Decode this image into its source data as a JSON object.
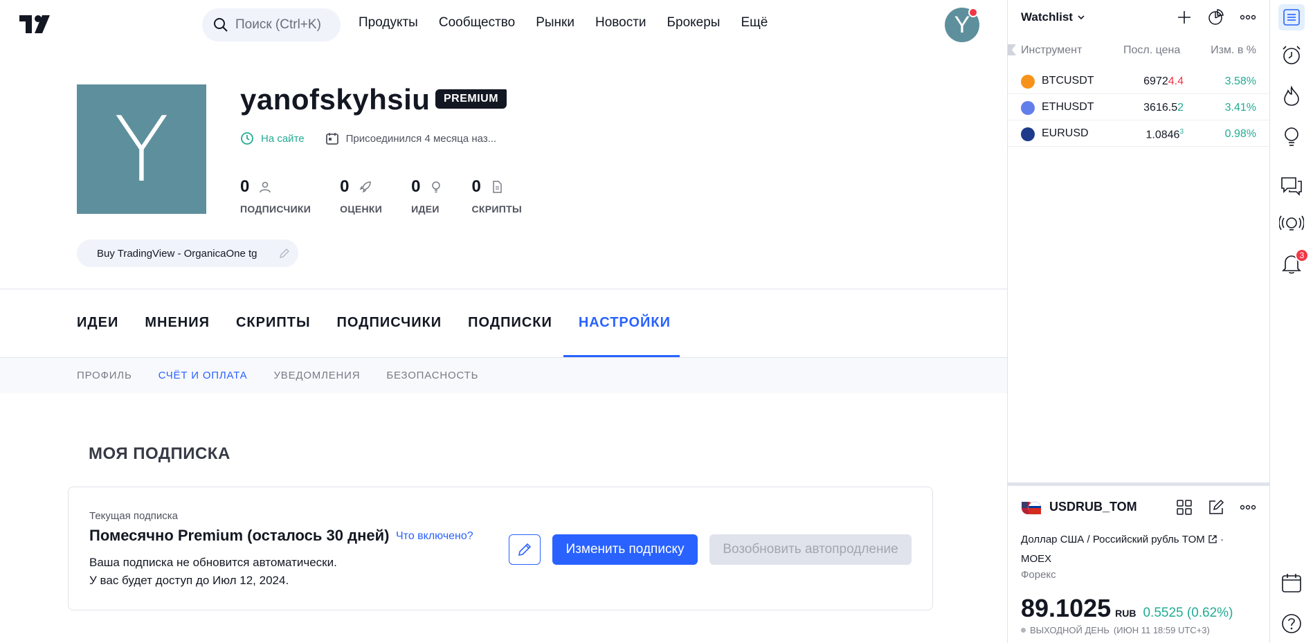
{
  "header": {
    "search_placeholder": "Поиск (Ctrl+K)",
    "nav": [
      "Продукты",
      "Сообщество",
      "Рынки",
      "Новости",
      "Брокеры",
      "Ещё"
    ],
    "avatar_letter": "Y"
  },
  "profile": {
    "avatar_letter": "Y",
    "username": "yanofskyhsiu",
    "badge": "PREMIUM",
    "online": "На сайте",
    "joined": "Присоединился 4 месяца наз...",
    "stats": [
      {
        "value": "0",
        "label": "ПОДПИСЧИКИ"
      },
      {
        "value": "0",
        "label": "ОЦЕНКИ"
      },
      {
        "value": "0",
        "label": "ИДЕИ"
      },
      {
        "value": "0",
        "label": "СКРИПТЫ"
      }
    ],
    "bio": "Buy TradingView - OrganicaOne tg"
  },
  "tabs": [
    "ИДЕИ",
    "МНЕНИЯ",
    "СКРИПТЫ",
    "ПОДПИСЧИКИ",
    "ПОДПИСКИ",
    "НАСТРОЙКИ"
  ],
  "active_tab": "НАСТРОЙКИ",
  "subtabs": [
    "ПРОФИЛЬ",
    "СЧЁТ И ОПЛАТА",
    "УВЕДОМЛЕНИЯ",
    "БЕЗОПАСНОСТЬ"
  ],
  "active_subtab": "СЧЁТ И ОПЛАТА",
  "subscription": {
    "section_title": "МОЯ ПОДПИСКА",
    "caption": "Текущая подписка",
    "plan": "Помесячно Premium (осталось 30 дней)",
    "included_link": "Что включено?",
    "line1": "Ваша подписка не обновится автоматически.",
    "line2": "У вас будет доступ до Июл 12, 2024.",
    "change_button": "Изменить подписку",
    "renew_button": "Возобновить автопродление"
  },
  "watchlist": {
    "title": "Watchlist",
    "columns": [
      "Инструмент",
      "Посл. цена",
      "Изм. в %"
    ],
    "rows": [
      {
        "symbol": "BTCUSDT",
        "price_main": "6972",
        "price_tail": "4.4",
        "tail_color": "red",
        "change": "3.58%",
        "icon_color": "#f7931a"
      },
      {
        "symbol": "ETHUSDT",
        "price_main": "3616.5",
        "price_tail": "2",
        "tail_color": "green",
        "change": "3.41%",
        "icon_color": "#627eea"
      },
      {
        "symbol": "EURUSD",
        "price_main": "1.0846",
        "price_tail": "3",
        "tail_color": "sup",
        "change": "0.98%",
        "icon_color": "#1e3a8a"
      }
    ]
  },
  "details": {
    "symbol": "USDRUB_TOM",
    "name_line1": "Доллар США",
    "name_line2": "Российский рубль TOM",
    "exchange": "MOEX",
    "category": "Форекс",
    "price": "89.1025",
    "currency": "RUB",
    "change": "0.5525 (0.62%)",
    "status": "ВЫХОДНОЙ ДЕНЬ",
    "time": "(ИЮН 11 18:59 UTC+3)"
  },
  "notifications_count": "3",
  "colors": {
    "accent": "#2962ff",
    "green": "#22ab94",
    "red": "#f23645",
    "avatar": "#5e8f9c"
  }
}
